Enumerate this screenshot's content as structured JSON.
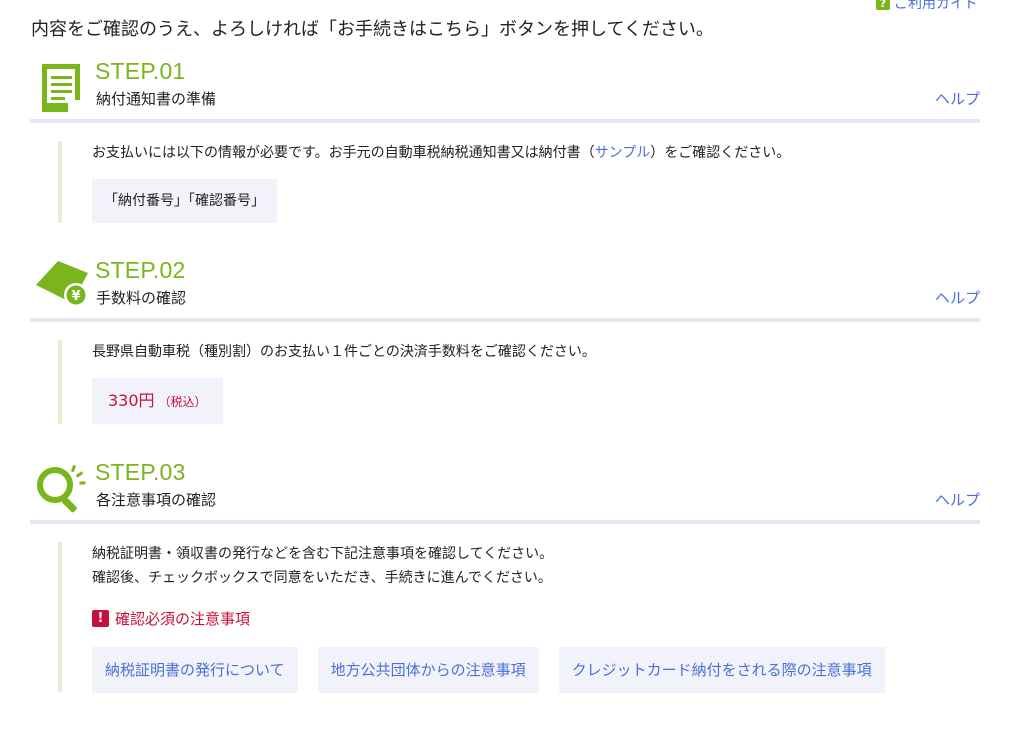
{
  "guide_link": "ご利用ガイド",
  "intro": "内容をご確認のうえ、よろしければ「お手続きはこちら」ボタンを押してください。",
  "help_label": "ヘルプ",
  "step1": {
    "number": "STEP.01",
    "title": "納付通知書の準備",
    "text_before": "お支払いには以下の情報が必要です。お手元の自動車税納税通知書又は納付書（",
    "sample_link": "サンプル",
    "text_after": "）をご確認ください。",
    "required_info": "「納付番号」「確認番号」"
  },
  "step2": {
    "number": "STEP.02",
    "title": "手数料の確認",
    "text": "長野県自動車税（種別割）のお支払い１件ごとの決済手数料をご確認ください。",
    "fee": "330円",
    "fee_note": "（税込）"
  },
  "step3": {
    "number": "STEP.03",
    "title": "各注意事項の確認",
    "text_line1": "納税証明書・領収書の発行などを含む下記注意事項を確認してください。",
    "text_line2": "確認後、チェックボックスで同意をいただき、手続きに進んでください。",
    "required_label": "確認必須の注意事項",
    "buttons": [
      "納税証明書の発行について",
      "地方公共団体からの注意事項",
      "クレジットカード納付をされる際の注意事項"
    ]
  },
  "colors": {
    "accent_green": "#7ab51d",
    "link_blue": "#4a6fd8",
    "alert_red": "#c8103e"
  }
}
